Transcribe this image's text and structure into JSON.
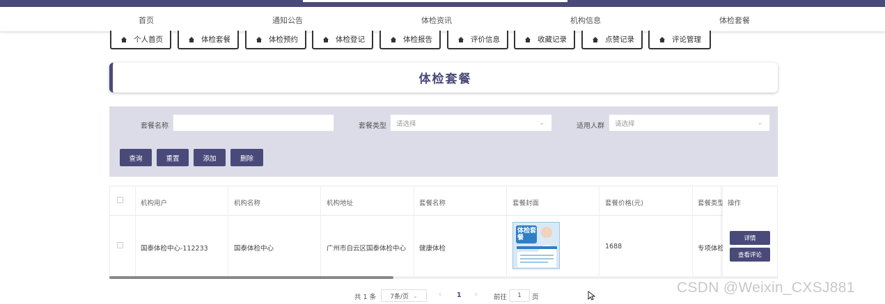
{
  "main_nav": [
    "首页",
    "通知公告",
    "体检资讯",
    "机构信息",
    "体检套餐"
  ],
  "sub_nav": [
    "个人首页",
    "体检套餐",
    "体检预约",
    "体检登记",
    "体检报告",
    "评价信息",
    "收藏记录",
    "点赞记录",
    "评论管理"
  ],
  "page_title": "体检套餐",
  "search": {
    "name_label": "套餐名称",
    "name_value": "",
    "type_label": "套餐类型",
    "type_placeholder": "请选择",
    "crowd_label": "适用人群",
    "crowd_placeholder": "请选择",
    "buttons": [
      "查询",
      "重置",
      "添加",
      "删除"
    ]
  },
  "table": {
    "columns": [
      "机构用户",
      "机构名称",
      "机构地址",
      "套餐名称",
      "套餐封面",
      "套餐价格(元)",
      "套餐类型",
      "操作"
    ],
    "rows": [
      {
        "org_user": "国泰体检中心-112233",
        "org_name": "国泰体检中心",
        "org_address": "广州市白云区国泰体检中心",
        "package_name": "健康体检",
        "price": "1688",
        "package_type": "专项体检"
      }
    ],
    "row_actions": [
      "详情",
      "查看评论"
    ]
  },
  "cover_image_text": "体检套餐",
  "pagination": {
    "total": "共 1 条",
    "page_size": "7条/页",
    "prev": "‹",
    "current": "1",
    "next": "›",
    "goto_label": "前往",
    "goto_value": "1",
    "page_unit": "页"
  },
  "watermark": "CSDN @Weixin_CXSJ881",
  "colors": {
    "primary": "#4a4a7a",
    "panel": "#dcdce8"
  }
}
